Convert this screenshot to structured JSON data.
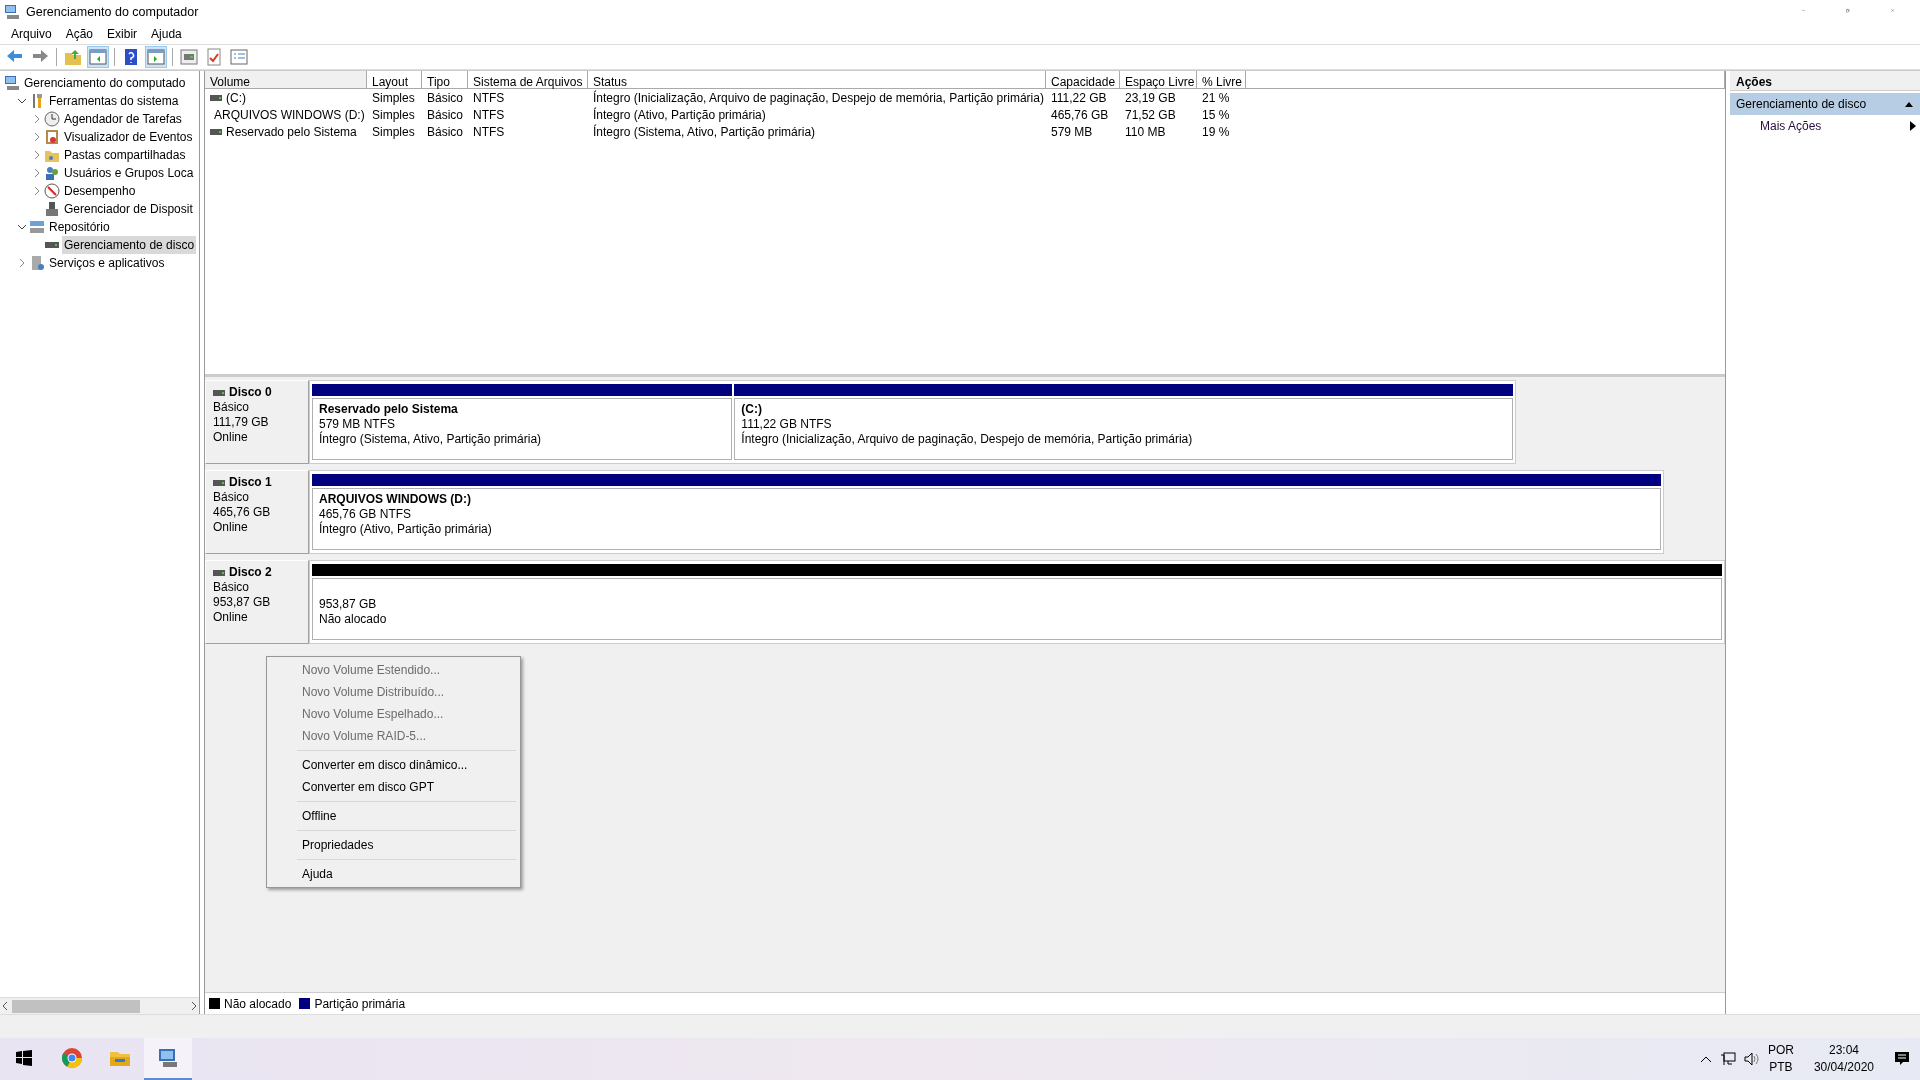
{
  "window": {
    "title": "Gerenciamento do computador"
  },
  "menu": [
    "Arquivo",
    "Ação",
    "Exibir",
    "Ajuda"
  ],
  "toolbar": [
    {
      "kind": "back",
      "pressed": false
    },
    {
      "kind": "forward",
      "pressed": false
    },
    {
      "kind": "sep"
    },
    {
      "kind": "up",
      "pressed": false
    },
    {
      "kind": "panel-left",
      "pressed": true
    },
    {
      "kind": "sep"
    },
    {
      "kind": "help",
      "pressed": false
    },
    {
      "kind": "panel-right",
      "pressed": true
    },
    {
      "kind": "sep"
    },
    {
      "kind": "connect",
      "pressed": false
    },
    {
      "kind": "check",
      "pressed": false
    },
    {
      "kind": "list",
      "pressed": false
    }
  ],
  "tree": [
    {
      "label": "Gerenciamento do computado",
      "kind": "computer",
      "selected": false,
      "children": [
        {
          "label": "Ferramentas do sistema",
          "kind": "tools",
          "expanded": true,
          "selected": false,
          "children": [
            {
              "label": "Agendador de Tarefas",
              "kind": "clock",
              "expanded": false,
              "selected": false
            },
            {
              "label": "Visualizador de Eventos",
              "kind": "log",
              "expanded": false,
              "selected": false
            },
            {
              "label": "Pastas compartilhadas",
              "kind": "folder",
              "expanded": false,
              "selected": false
            },
            {
              "label": "Usuários e Grupos Loca",
              "kind": "users",
              "expanded": false,
              "selected": false
            },
            {
              "label": "Desempenho",
              "kind": "gauge",
              "expanded": false,
              "selected": false
            },
            {
              "label": "Gerenciador de Disposit",
              "kind": "device",
              "selected": false
            }
          ]
        },
        {
          "label": "Repositório",
          "kind": "storage",
          "expanded": true,
          "selected": false,
          "children": [
            {
              "label": "Gerenciamento de disco",
              "kind": "drive",
              "selected": true
            }
          ]
        },
        {
          "label": "Serviços e aplicativos",
          "kind": "server",
          "expanded": false,
          "selected": false
        }
      ]
    }
  ],
  "volumes": {
    "columns": [
      "Volume",
      "Layout",
      "Tipo",
      "Sistema de Arquivos",
      "Status",
      "Capacidade",
      "Espaço Livre",
      "% Livre"
    ],
    "rows": [
      [
        "(C:)",
        "Simples",
        "Básico",
        "NTFS",
        "Íntegro (Inicialização, Arquivo de paginação, Despejo de memória, Partição primária)",
        "111,22 GB",
        "23,19 GB",
        "21 %"
      ],
      [
        "ARQUIVOS WINDOWS (D:)",
        "Simples",
        "Básico",
        "NTFS",
        "Íntegro (Ativo, Partição primária)",
        "465,76 GB",
        "71,52 GB",
        "15 %"
      ],
      [
        "Reservado pelo Sistema",
        "Simples",
        "Básico",
        "NTFS",
        "Íntegro (Sistema, Ativo, Partição primária)",
        "579 MB",
        "110 MB",
        "19 %"
      ]
    ]
  },
  "disks": [
    {
      "name": "Disco 0",
      "type": "Básico",
      "size": "111,79 GB",
      "status": "Online",
      "partitions": [
        {
          "kind": "primary",
          "title": "Reservado pelo Sistema",
          "size": "579 MB NTFS",
          "status": "Íntegro (Sistema, Ativo, Partição primária)"
        },
        {
          "kind": "primary",
          "title": "(C:)",
          "size": "111,22 GB NTFS",
          "status": "Íntegro (Inicialização, Arquivo de paginação, Despejo de memória, Partição primária)"
        }
      ]
    },
    {
      "name": "Disco 1",
      "type": "Básico",
      "size": "465,76 GB",
      "status": "Online",
      "partitions": [
        {
          "kind": "primary",
          "title": "ARQUIVOS WINDOWS  (D:)",
          "size": "465,76 GB NTFS",
          "status": "Íntegro (Ativo, Partição primária)"
        }
      ]
    },
    {
      "name": "Disco 2",
      "type": "Básico",
      "size": "953,87 GB",
      "status": "Online",
      "partitions": [
        {
          "kind": "unallocated",
          "size": "953,87 GB",
          "status": "Não alocado"
        }
      ]
    }
  ],
  "context_menu": [
    [
      {
        "label": "Novo Volume Estendido...",
        "disabled": true
      },
      {
        "label": "Novo Volume Distribuído...",
        "disabled": true
      },
      {
        "label": "Novo Volume Espelhado...",
        "disabled": true
      },
      {
        "label": "Novo Volume RAID-5...",
        "disabled": true
      }
    ],
    [
      {
        "label": "Converter em disco dinâmico...",
        "disabled": false
      },
      {
        "label": "Converter em disco GPT",
        "disabled": false
      }
    ],
    [
      {
        "label": "Offline",
        "disabled": false
      }
    ],
    [
      {
        "label": "Propriedades",
        "disabled": false
      }
    ],
    [
      {
        "label": "Ajuda",
        "disabled": false
      }
    ]
  ],
  "legend": [
    {
      "label": "Não alocado",
      "color": "#000000"
    },
    {
      "label": "Partição primária",
      "color": "#00007f"
    }
  ],
  "actions": {
    "title": "Ações",
    "section": "Gerenciamento de disco",
    "items": [
      "Mais Ações"
    ]
  },
  "taskbar": {
    "apps": [
      {
        "kind": "browser",
        "active": false
      },
      {
        "kind": "folder",
        "active": false
      },
      {
        "kind": "computer",
        "active": true
      }
    ],
    "language": [
      "POR",
      "PTB"
    ],
    "time": "23:04",
    "date": "30/04/2020"
  }
}
